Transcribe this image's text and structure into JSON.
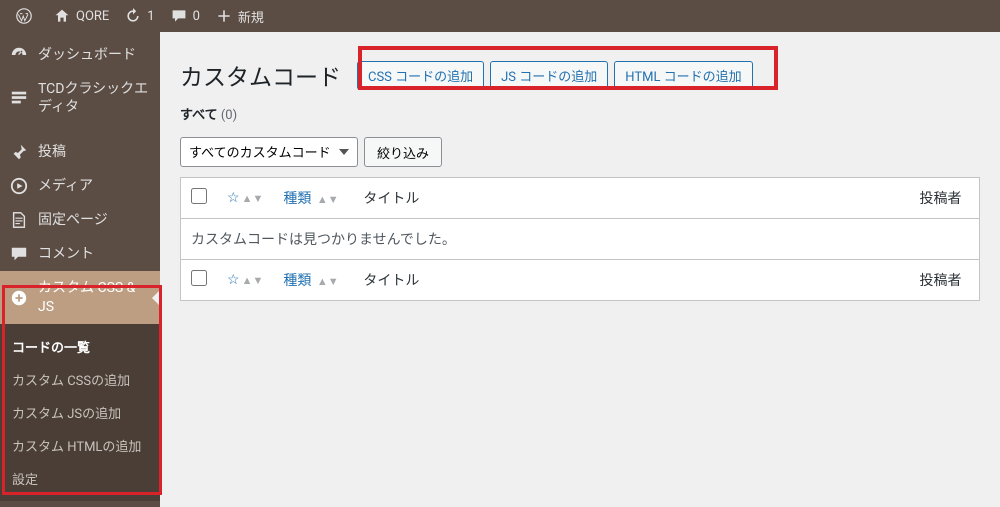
{
  "adminbar": {
    "site_name": "QORE",
    "updates_count": "1",
    "comments_count": "0",
    "new_label": "新規"
  },
  "sidebar": {
    "items": [
      {
        "label": "ダッシュボード"
      },
      {
        "label": "TCDクラシックエディタ"
      },
      {
        "label": "投稿"
      },
      {
        "label": "メディア"
      },
      {
        "label": "固定ページ"
      },
      {
        "label": "コメント"
      },
      {
        "label": "カスタム CSS & JS"
      }
    ],
    "submenu": [
      {
        "label": "コードの一覧",
        "active": true
      },
      {
        "label": "カスタム CSSの追加"
      },
      {
        "label": "カスタム JSの追加"
      },
      {
        "label": "カスタム HTMLの追加"
      },
      {
        "label": "設定"
      }
    ]
  },
  "page": {
    "title": "カスタムコード",
    "actions": [
      {
        "label": "CSS コードの追加"
      },
      {
        "label": "JS コードの追加"
      },
      {
        "label": "HTML コードの追加"
      }
    ],
    "subsubsub": {
      "label": "すべて",
      "count": "(0)"
    },
    "filter_select": "すべてのカスタムコード",
    "filter_button": "絞り込み",
    "columns": {
      "type": "種類",
      "title": "タイトル",
      "author": "投稿者"
    },
    "empty_message": "カスタムコードは見つかりませんでした。"
  }
}
